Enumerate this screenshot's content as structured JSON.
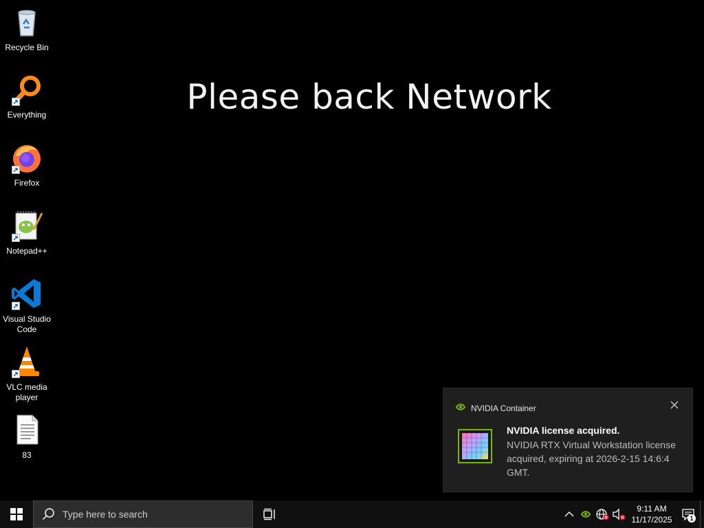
{
  "wallpaper": {
    "text": "Please back Network"
  },
  "desktop_icons": [
    {
      "label": "Recycle Bin",
      "icon": "recycle-bin-icon"
    },
    {
      "label": "Everything",
      "icon": "everything-search-icon"
    },
    {
      "label": "Firefox",
      "icon": "firefox-icon"
    },
    {
      "label": "Notepad++",
      "icon": "notepadpp-icon"
    },
    {
      "label": "Visual Studio Code",
      "icon": "vscode-icon"
    },
    {
      "label": "VLC media player",
      "icon": "vlc-icon"
    },
    {
      "label": "83",
      "icon": "text-file-icon"
    }
  ],
  "notification": {
    "app_name": "NVIDIA Container",
    "title": "NVIDIA license acquired.",
    "message": "NVIDIA RTX Virtual Workstation license acquired, expiring at 2026-2-15 14:6:4 GMT.",
    "accent": "#76b900"
  },
  "taskbar": {
    "search_placeholder": "Type here to search",
    "time": "9:11 AM",
    "date": "11/17/2025",
    "notification_count": "1"
  }
}
